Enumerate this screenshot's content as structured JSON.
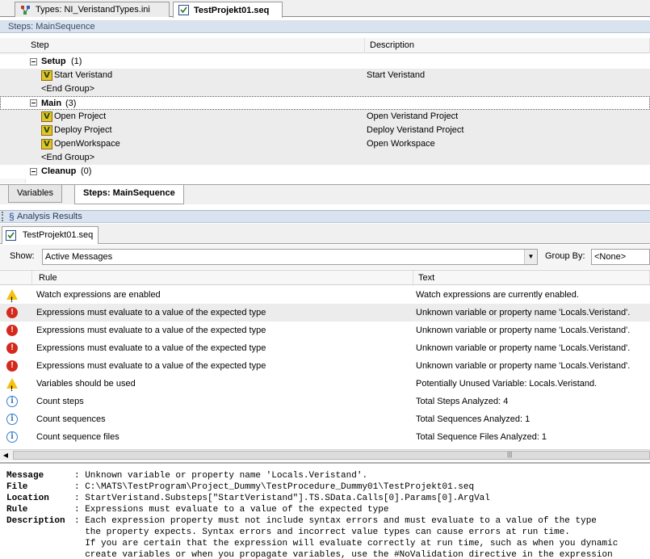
{
  "doc_tabs": [
    {
      "label": "Types: NI_VeristandTypes.ini",
      "icon": "types-file-icon"
    },
    {
      "label": "TestProjekt01.seq",
      "icon": "sequence-file-icon",
      "active": true
    }
  ],
  "steps_pane": {
    "title": "Steps: MainSequence",
    "col_step": "Step",
    "col_description": "Description",
    "rows": [
      {
        "type": "group",
        "name": "Setup",
        "count": "(1)"
      },
      {
        "type": "step",
        "name": "Start Veristand",
        "description": "Start Veristand"
      },
      {
        "type": "end",
        "name": "<End Group>"
      },
      {
        "type": "group",
        "name": "Main",
        "count": "(3)"
      },
      {
        "type": "step",
        "name": "Open Project",
        "description": "Open Veristand Project"
      },
      {
        "type": "step",
        "name": "Deploy Project",
        "description": "Deploy Veristand Project"
      },
      {
        "type": "step",
        "name": "OpenWorkspace",
        "description": "Open Workspace"
      },
      {
        "type": "end",
        "name": "<End Group>"
      },
      {
        "type": "group",
        "name": "Cleanup",
        "count": "(0)"
      }
    ]
  },
  "bottom_tabs": [
    {
      "label": "Variables"
    },
    {
      "label": "Steps: MainSequence",
      "active": true
    }
  ],
  "analysis": {
    "title": "Analysis Results",
    "file_tab": "TestProjekt01.seq",
    "show_label": "Show:",
    "show_value": "Active Messages",
    "group_by_label": "Group By:",
    "group_by_value": "<None>",
    "col_rule": "Rule",
    "col_text": "Text",
    "rows": [
      {
        "severity": "warning",
        "rule": "Watch expressions are enabled",
        "text": "Watch expressions are currently enabled."
      },
      {
        "severity": "error",
        "rule": "Expressions must evaluate to a value of the expected type",
        "text": "Unknown variable or property name 'Locals.Veristand'."
      },
      {
        "severity": "error",
        "rule": "Expressions must evaluate to a value of the expected type",
        "text": "Unknown variable or property name 'Locals.Veristand'."
      },
      {
        "severity": "error",
        "rule": "Expressions must evaluate to a value of the expected type",
        "text": "Unknown variable or property name 'Locals.Veristand'."
      },
      {
        "severity": "error",
        "rule": "Expressions must evaluate to a value of the expected type",
        "text": "Unknown variable or property name 'Locals.Veristand'."
      },
      {
        "severity": "warning",
        "rule": "Variables should be used",
        "text": "Potentially Unused Variable: Locals.Veristand."
      },
      {
        "severity": "info",
        "rule": "Count steps",
        "text": "Total Steps Analyzed: 4"
      },
      {
        "severity": "info",
        "rule": "Count sequences",
        "text": "Total Sequences Analyzed: 1"
      },
      {
        "severity": "info",
        "rule": "Count sequence files",
        "text": "Total Sequence Files Analyzed: 1"
      }
    ]
  },
  "detail": {
    "message_key": "Message",
    "message_val": ": Unknown variable or property name 'Locals.Veristand'.",
    "file_key": "File",
    "file_val": ": C:\\MATS\\TestProgram\\Project_Dummy\\TestProcedure_Dummy01\\TestProjekt01.seq",
    "location_key": "Location",
    "location_val": ": StartVeristand.Substeps[\"StartVeristand\"].TS.SData.Calls[0].Params[0].ArgVal",
    "rule_key": "Rule",
    "rule_val": ": Expressions must evaluate to a value of the expected type",
    "description_key": "Description",
    "description_val": ": Each expression property must not include syntax errors and must evaluate to a value of the type",
    "description_line2": "  the property expects. Syntax errors and incorrect value types can cause errors at run time.",
    "description_line3": "  If you are certain that the expression will evaluate correctly at run time, such as when you dynamic",
    "description_line4": "  create variables or when you propagate variables, use the #NoValidation directive in the expression"
  }
}
